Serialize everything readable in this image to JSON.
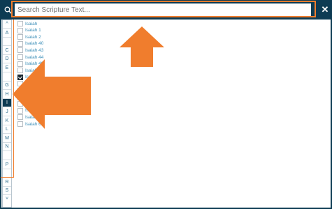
{
  "search": {
    "placeholder": "Search Scripture Text...",
    "value": ""
  },
  "close_label": "✕",
  "alphabet": [
    {
      "letter": "^"
    },
    {
      "letter": "A"
    },
    {
      "letter": ""
    },
    {
      "letter": "C"
    },
    {
      "letter": "D"
    },
    {
      "letter": "E"
    },
    {
      "letter": ""
    },
    {
      "letter": "G"
    },
    {
      "letter": "H"
    },
    {
      "letter": "I",
      "active": true
    },
    {
      "letter": "J"
    },
    {
      "letter": "K"
    },
    {
      "letter": "L"
    },
    {
      "letter": "M"
    },
    {
      "letter": "N"
    },
    {
      "letter": ""
    },
    {
      "letter": "P"
    },
    {
      "letter": ""
    },
    {
      "letter": "R"
    },
    {
      "letter": "S"
    }
  ],
  "scroll_down": "˅",
  "results": [
    {
      "label": "Isaiah",
      "checked": false
    },
    {
      "label": "Isaiah 1",
      "checked": false
    },
    {
      "label": "Isaiah 2",
      "checked": false
    },
    {
      "label": "Isaiah 40",
      "checked": false
    },
    {
      "label": "Isaiah 43",
      "checked": false
    },
    {
      "label": "Isaiah 44",
      "checked": false
    },
    {
      "label": "Isaiah 49",
      "checked": false
    },
    {
      "label": "Isaiah 52",
      "checked": false
    },
    {
      "label": "Isaiah 5",
      "checked": true
    },
    {
      "label": "Isa",
      "checked": false
    },
    {
      "label": "",
      "checked": false
    },
    {
      "label": "",
      "checked": false
    },
    {
      "label": "",
      "checked": false
    },
    {
      "label": "Isaiah",
      "checked": false
    },
    {
      "label": "Isaiah 6",
      "checked": false
    },
    {
      "label": "Isaiah 64",
      "checked": false
    }
  ],
  "colors": {
    "header": "#0d3b53",
    "accent_orange": "#f07d2d",
    "link_blue": "#3d8fb8"
  }
}
